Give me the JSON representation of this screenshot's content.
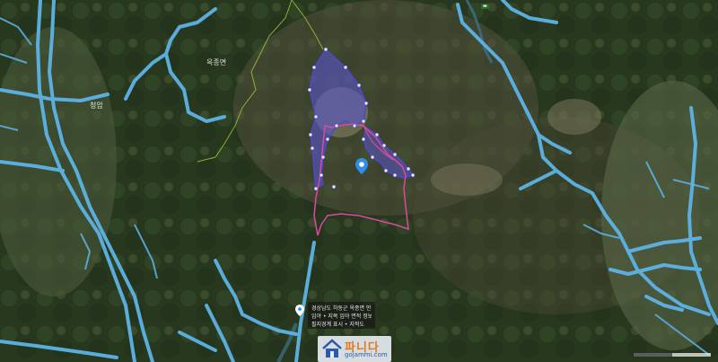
{
  "map": {
    "type": "satellite",
    "road_color": "#5db3e6",
    "parcel_fill_color": "#5a56d8",
    "parcel_outline_color": "#d94aa0",
    "admin_boundary_color": "#a6c93a"
  },
  "location_pin": {
    "icon": "map-pin-icon",
    "color": "#2f8fe6"
  },
  "info_callout": {
    "line1": "경상남도 하동군 옥종면 안계리 산",
    "line2": "임야 • 지목 임야 면적 정보",
    "line3": "필지경계 표시 • 지적도"
  },
  "watermark": {
    "brand": "파니다",
    "domain": "gojammi.com"
  },
  "labels": {
    "place1": "옥종면",
    "place2": "청암"
  }
}
